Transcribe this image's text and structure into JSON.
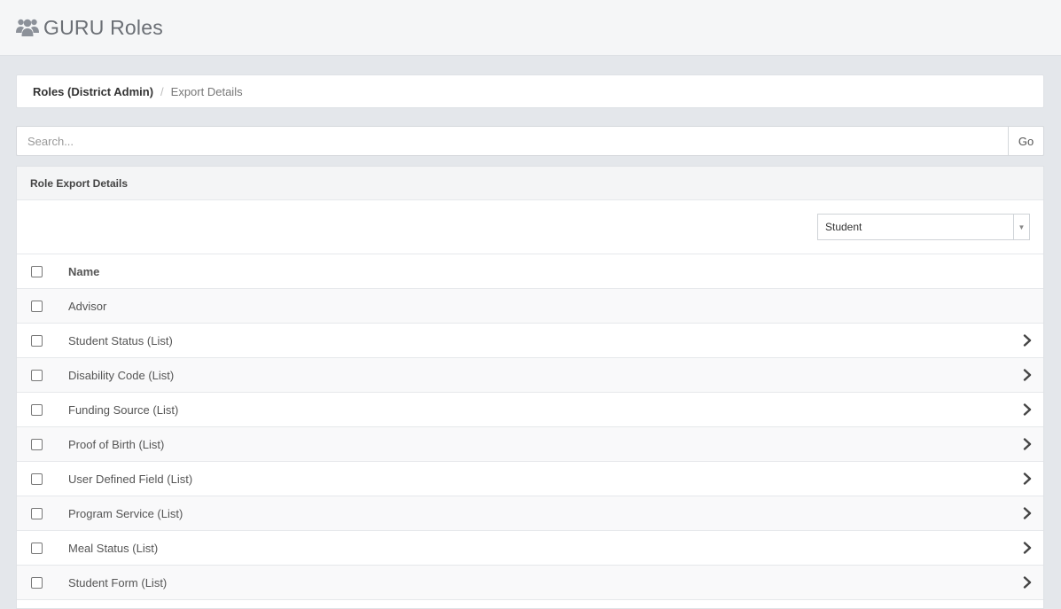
{
  "header": {
    "icon": "users-icon",
    "title": "GURU Roles"
  },
  "breadcrumb": {
    "link": "Roles (District Admin)",
    "separator": "/",
    "current": "Export Details"
  },
  "search": {
    "placeholder": "Search...",
    "value": "",
    "go_label": "Go"
  },
  "panel": {
    "title": "Role Export Details",
    "filter": {
      "selected": "Student"
    },
    "table": {
      "header": "Name",
      "rows": [
        {
          "label": "Advisor",
          "has_chevron": false
        },
        {
          "label": "Student Status (List)",
          "has_chevron": true
        },
        {
          "label": "Disability Code (List)",
          "has_chevron": true
        },
        {
          "label": "Funding Source (List)",
          "has_chevron": true
        },
        {
          "label": "Proof of Birth (List)",
          "has_chevron": true
        },
        {
          "label": "User Defined Field (List)",
          "has_chevron": true
        },
        {
          "label": "Program Service (List)",
          "has_chevron": true
        },
        {
          "label": "Meal Status (List)",
          "has_chevron": true
        },
        {
          "label": "Student Form (List)",
          "has_chevron": true
        }
      ]
    }
  }
}
